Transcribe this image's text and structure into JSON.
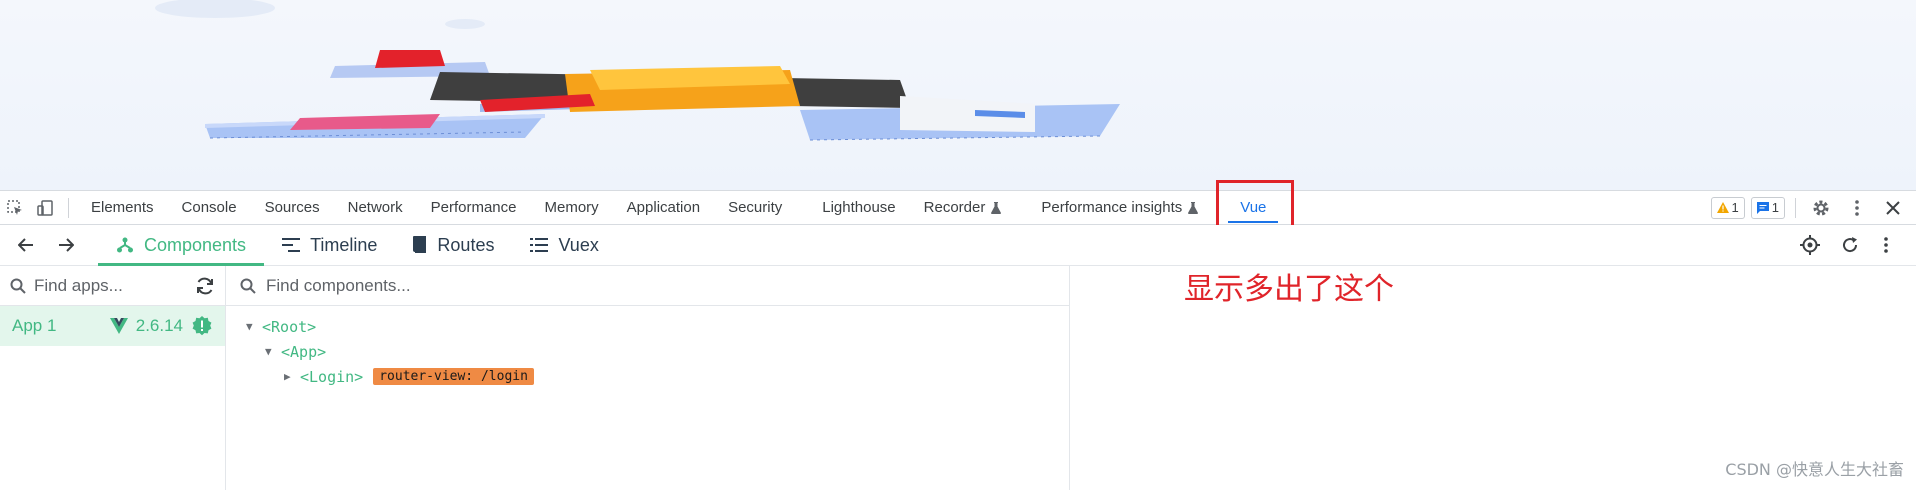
{
  "devtools": {
    "tabs": [
      {
        "label": "Elements",
        "experimental": false,
        "active": false
      },
      {
        "label": "Console",
        "experimental": false,
        "active": false
      },
      {
        "label": "Sources",
        "experimental": false,
        "active": false
      },
      {
        "label": "Network",
        "experimental": false,
        "active": false
      },
      {
        "label": "Performance",
        "experimental": false,
        "active": false
      },
      {
        "label": "Memory",
        "experimental": false,
        "active": false
      },
      {
        "label": "Application",
        "experimental": false,
        "active": false
      },
      {
        "label": "Security",
        "experimental": false,
        "active": false
      },
      {
        "label": "Lighthouse",
        "experimental": false,
        "active": false
      },
      {
        "label": "Recorder",
        "experimental": true,
        "active": false
      },
      {
        "label": "Performance insights",
        "experimental": true,
        "active": false
      },
      {
        "label": "Vue",
        "experimental": false,
        "active": true
      }
    ],
    "warnings_count": "1",
    "messages_count": "1"
  },
  "vue_toolbar": {
    "tabs": [
      {
        "label": "Components",
        "icon": "components-icon",
        "active": true
      },
      {
        "label": "Timeline",
        "icon": "timeline-icon",
        "active": false
      },
      {
        "label": "Routes",
        "icon": "routes-icon",
        "active": false
      },
      {
        "label": "Vuex",
        "icon": "vuex-icon",
        "active": false
      }
    ]
  },
  "apps": {
    "search_placeholder": "Find apps...",
    "items": [
      {
        "name": "App 1",
        "version": "2.6.14"
      }
    ]
  },
  "components": {
    "search_placeholder": "Find components...",
    "tree": [
      {
        "name": "<Root>",
        "expanded": true,
        "tag": ""
      },
      {
        "name": "<App>",
        "expanded": true,
        "tag": ""
      },
      {
        "name": "<Login>",
        "expanded": false,
        "tag": "router-view: /login"
      }
    ]
  },
  "annotation_text": "显示多出了这个",
  "watermark": "CSDN @快意人生大社畜",
  "colors": {
    "vue_green": "#42b883",
    "devtools_blue": "#1a73e8",
    "annotation_red": "#e0242a",
    "router_tag": "#ef8a44"
  }
}
